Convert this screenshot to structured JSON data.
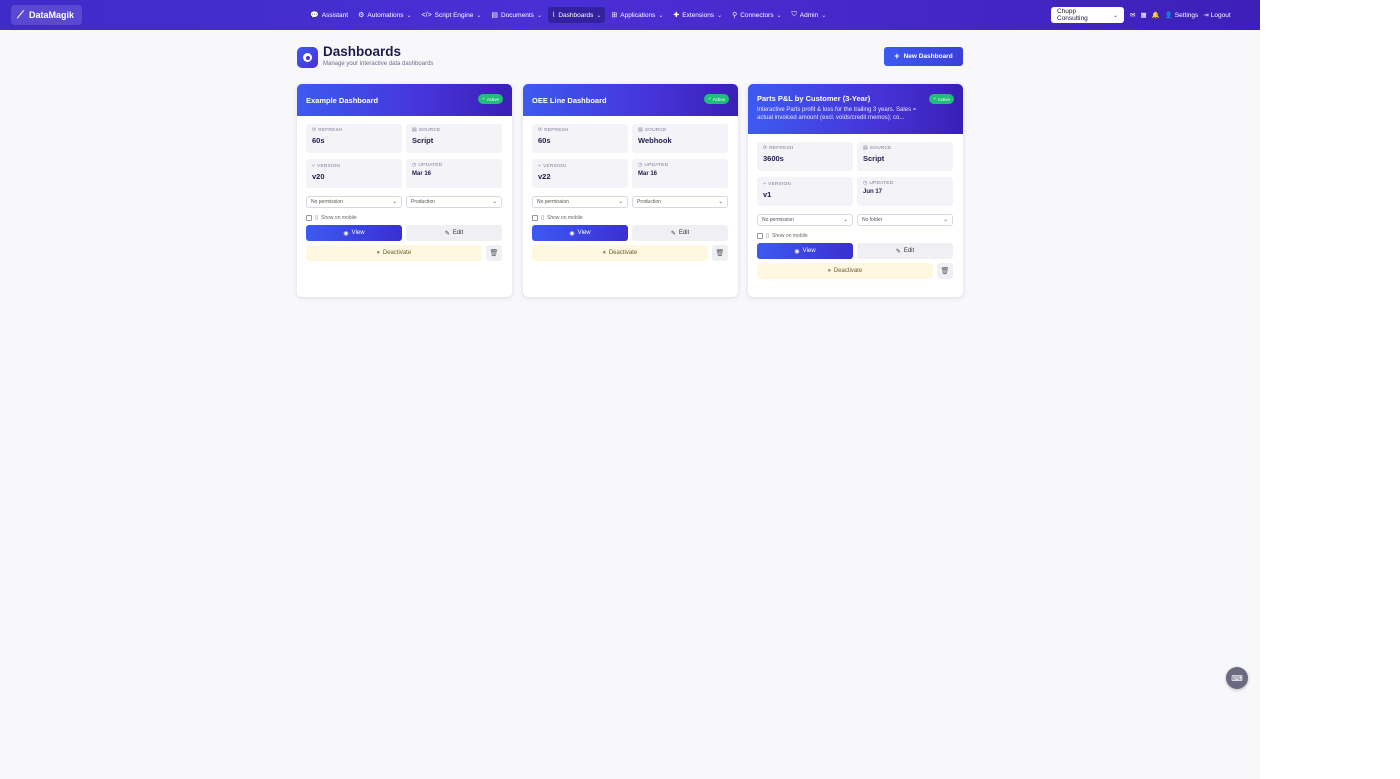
{
  "navbar": {
    "brand": "DataMagik",
    "items": [
      {
        "label": "Assistant",
        "icon": "chat-icon",
        "glyph": "💬",
        "dropdown": false,
        "active": false
      },
      {
        "label": "Automations",
        "icon": "robot-icon",
        "glyph": "⚙",
        "dropdown": true,
        "active": false
      },
      {
        "label": "Script Engine",
        "icon": "code-icon",
        "glyph": "</>",
        "dropdown": true,
        "active": false
      },
      {
        "label": "Documents",
        "icon": "document-icon",
        "glyph": "▤",
        "dropdown": true,
        "active": false
      },
      {
        "label": "Dashboards",
        "icon": "chart-icon",
        "glyph": "⌇",
        "dropdown": true,
        "active": true
      },
      {
        "label": "Applications",
        "icon": "grid-icon",
        "glyph": "⊞",
        "dropdown": true,
        "active": false
      },
      {
        "label": "Extensions",
        "icon": "puzzle-icon",
        "glyph": "✚",
        "dropdown": true,
        "active": false
      },
      {
        "label": "Connectors",
        "icon": "plug-icon",
        "glyph": "⚲",
        "dropdown": true,
        "active": false
      },
      {
        "label": "Admin",
        "icon": "shield-icon",
        "glyph": "⛉",
        "dropdown": true,
        "active": false
      }
    ],
    "company": "Chupp Consulting",
    "settings_label": "Settings",
    "logout_label": "Logout"
  },
  "header": {
    "title": "Dashboards",
    "subtitle": "Manage your interactive data dashboards",
    "new_button": "New Dashboard"
  },
  "labels": {
    "refresh": "REFRESH",
    "source": "SOURCE",
    "version": "VERSION",
    "updated": "UPDATED",
    "show_mobile": "Show on mobile",
    "view": "View",
    "edit": "Edit",
    "deactivate": "Deactivate",
    "active_badge": "Active"
  },
  "cards": [
    {
      "title": "Example Dashboard",
      "description": "",
      "refresh": "60s",
      "source": "Script",
      "version": "v20",
      "updated": "Mar 16",
      "permission": "No permission",
      "folder": "Production"
    },
    {
      "title": "OEE Line Dashboard",
      "description": "",
      "refresh": "60s",
      "source": "Webhook",
      "version": "v22",
      "updated": "Mar 16",
      "permission": "No permission",
      "folder": "Production"
    },
    {
      "title": "Parts P&L by Customer (3-Year)",
      "description": "Interactive Parts profit & loss for the trailing 3 years. Sales = actual invoiced amount (excl. voids/credit memos); co...",
      "refresh": "3600s",
      "source": "Script",
      "version": "v1",
      "updated": "Jun 17",
      "permission": "No permission",
      "folder": "No folder"
    }
  ],
  "colors": {
    "navbar": "#4b2fd6",
    "accent": "#3d5af1",
    "active_badge": "#1fbf7a",
    "deactivate_bg": "#fff8e1"
  }
}
